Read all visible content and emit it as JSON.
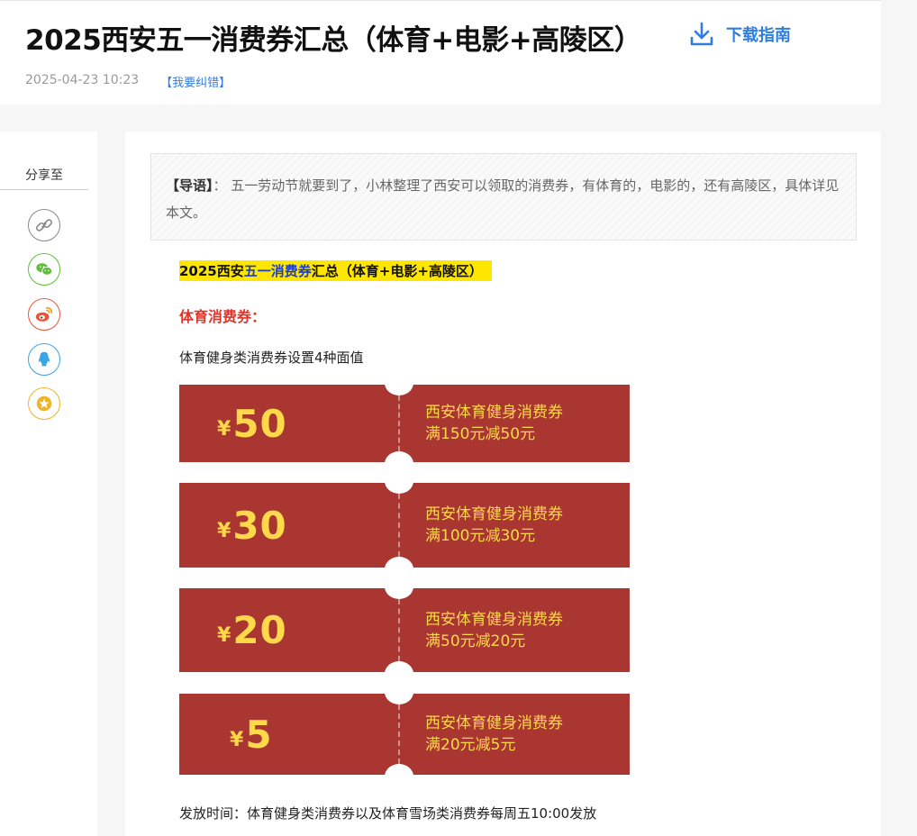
{
  "header": {
    "title": "2025西安五一消费券汇总（体育+电影+高陵区）",
    "download_label": "下载指南",
    "date": "2025-04-23 10:23",
    "report_link": "【我要纠错】"
  },
  "share": {
    "title": "分享至",
    "icons": [
      "link-icon",
      "wechat-icon",
      "weibo-icon",
      "qq-icon",
      "favorite-icon"
    ]
  },
  "article": {
    "intro_label": "【导语】",
    "intro_text": "： 五一劳动节就要到了，小林整理了西安可以领取的消费券，有体育的，电影的，还有高陵区，具体详见本文。",
    "heading_part1": "2025西安",
    "heading_part2": "五一消费券",
    "heading_part3": "汇总（体育+电影+高陵区）",
    "section_title": "体育消费券：",
    "para1": "体育健身类消费券设置4种面值",
    "coupons": [
      {
        "yen": "¥",
        "amount": "50",
        "name": "西安体育健身消费券",
        "rule": "满150元减50元"
      },
      {
        "yen": "¥",
        "amount": "30",
        "name": "西安体育健身消费券",
        "rule": "满100元减30元"
      },
      {
        "yen": "¥",
        "amount": "20",
        "name": "西安体育健身消费券",
        "rule": "满50元减20元"
      },
      {
        "yen": "¥",
        "amount": "5",
        "name": "西安体育健身消费券",
        "rule": "满20元减5元"
      }
    ],
    "para2": "发放时间：体育健身类消费券以及体育雪场类消费券每周五10:00发放"
  },
  "colors": {
    "accent": "#2f7de1",
    "coupon_bg": "#a93630",
    "coupon_text": "#ffd94a",
    "highlight": "#ffe600",
    "section_red": "#e0342a"
  }
}
